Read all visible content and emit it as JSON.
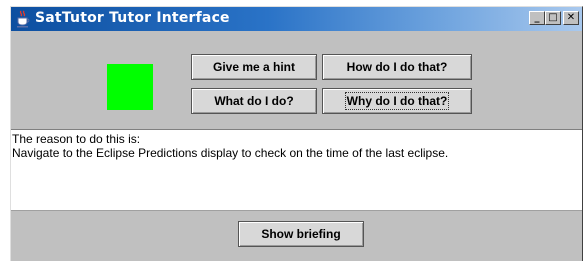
{
  "window": {
    "title": "SatTutor Tutor Interface",
    "controls": {
      "minimize": "_",
      "maximize": "□",
      "close": "✕"
    }
  },
  "status_indicator": {
    "color": "#00ff00"
  },
  "buttons": {
    "hint": "Give me a hint",
    "how": "How do I do that?",
    "what": "What do I do?",
    "why": "Why do I do that?",
    "briefing": "Show briefing"
  },
  "message": {
    "line1": "The reason to do this is:",
    "line2": "Navigate to the Eclipse Predictions display to check on the time of the last eclipse."
  },
  "colors": {
    "title_bar": "#0d4fa0",
    "panel": "#c0c0c0"
  }
}
